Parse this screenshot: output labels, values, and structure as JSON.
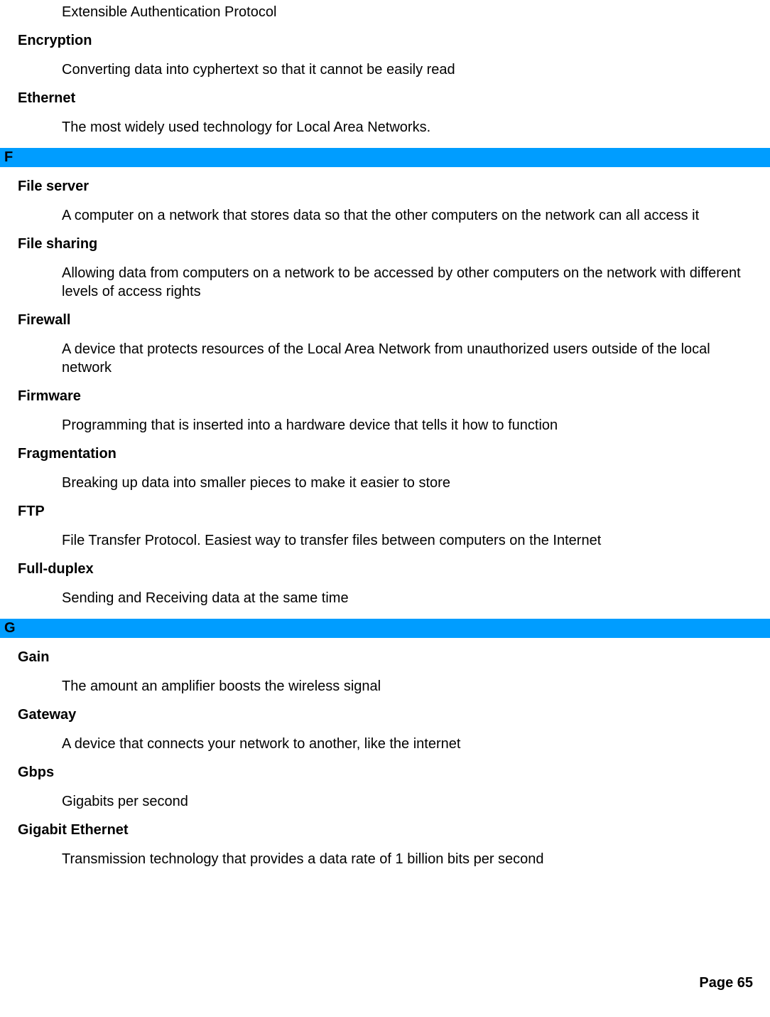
{
  "preSection": {
    "entries": [
      {
        "term": null,
        "definition": "Extensible Authentication Protocol"
      },
      {
        "term": "Encryption",
        "definition": "Converting data into cyphertext so that it cannot be easily read"
      },
      {
        "term": "Ethernet",
        "definition": "The most widely used technology for Local Area Networks."
      }
    ]
  },
  "sections": [
    {
      "header": "F",
      "entries": [
        {
          "term": "File server",
          "definition": "A computer on a network that stores data so that the other computers on the network can all access it"
        },
        {
          "term": "File sharing",
          "definition": "Allowing data from computers on a network to be accessed by other computers on the network with different levels of access rights"
        },
        {
          "term": "Firewall",
          "definition": "A device that protects resources of the Local Area Network from unauthorized users outside of the local network"
        },
        {
          "term": "Firmware",
          "definition": "Programming that is inserted into a hardware device that tells it how to function"
        },
        {
          "term": "Fragmentation",
          "definition": "Breaking up data into smaller pieces to make it easier to store"
        },
        {
          "term": "FTP",
          "definition": "File Transfer Protocol. Easiest way to transfer files between computers on the Internet"
        },
        {
          "term": "Full-duplex",
          "definition": "Sending and Receiving data at the same time"
        }
      ]
    },
    {
      "header": "G",
      "entries": [
        {
          "term": "Gain",
          "definition": "The amount an amplifier boosts the wireless signal"
        },
        {
          "term": "Gateway",
          "definition": "A device that connects your network to another, like the internet"
        },
        {
          "term": "Gbps",
          "definition": "Gigabits per second"
        },
        {
          "term": "Gigabit Ethernet",
          "definition": "Transmission technology that provides a data rate of 1 billion bits per second"
        }
      ]
    }
  ],
  "footer": {
    "pageLabel": "Page  65"
  }
}
